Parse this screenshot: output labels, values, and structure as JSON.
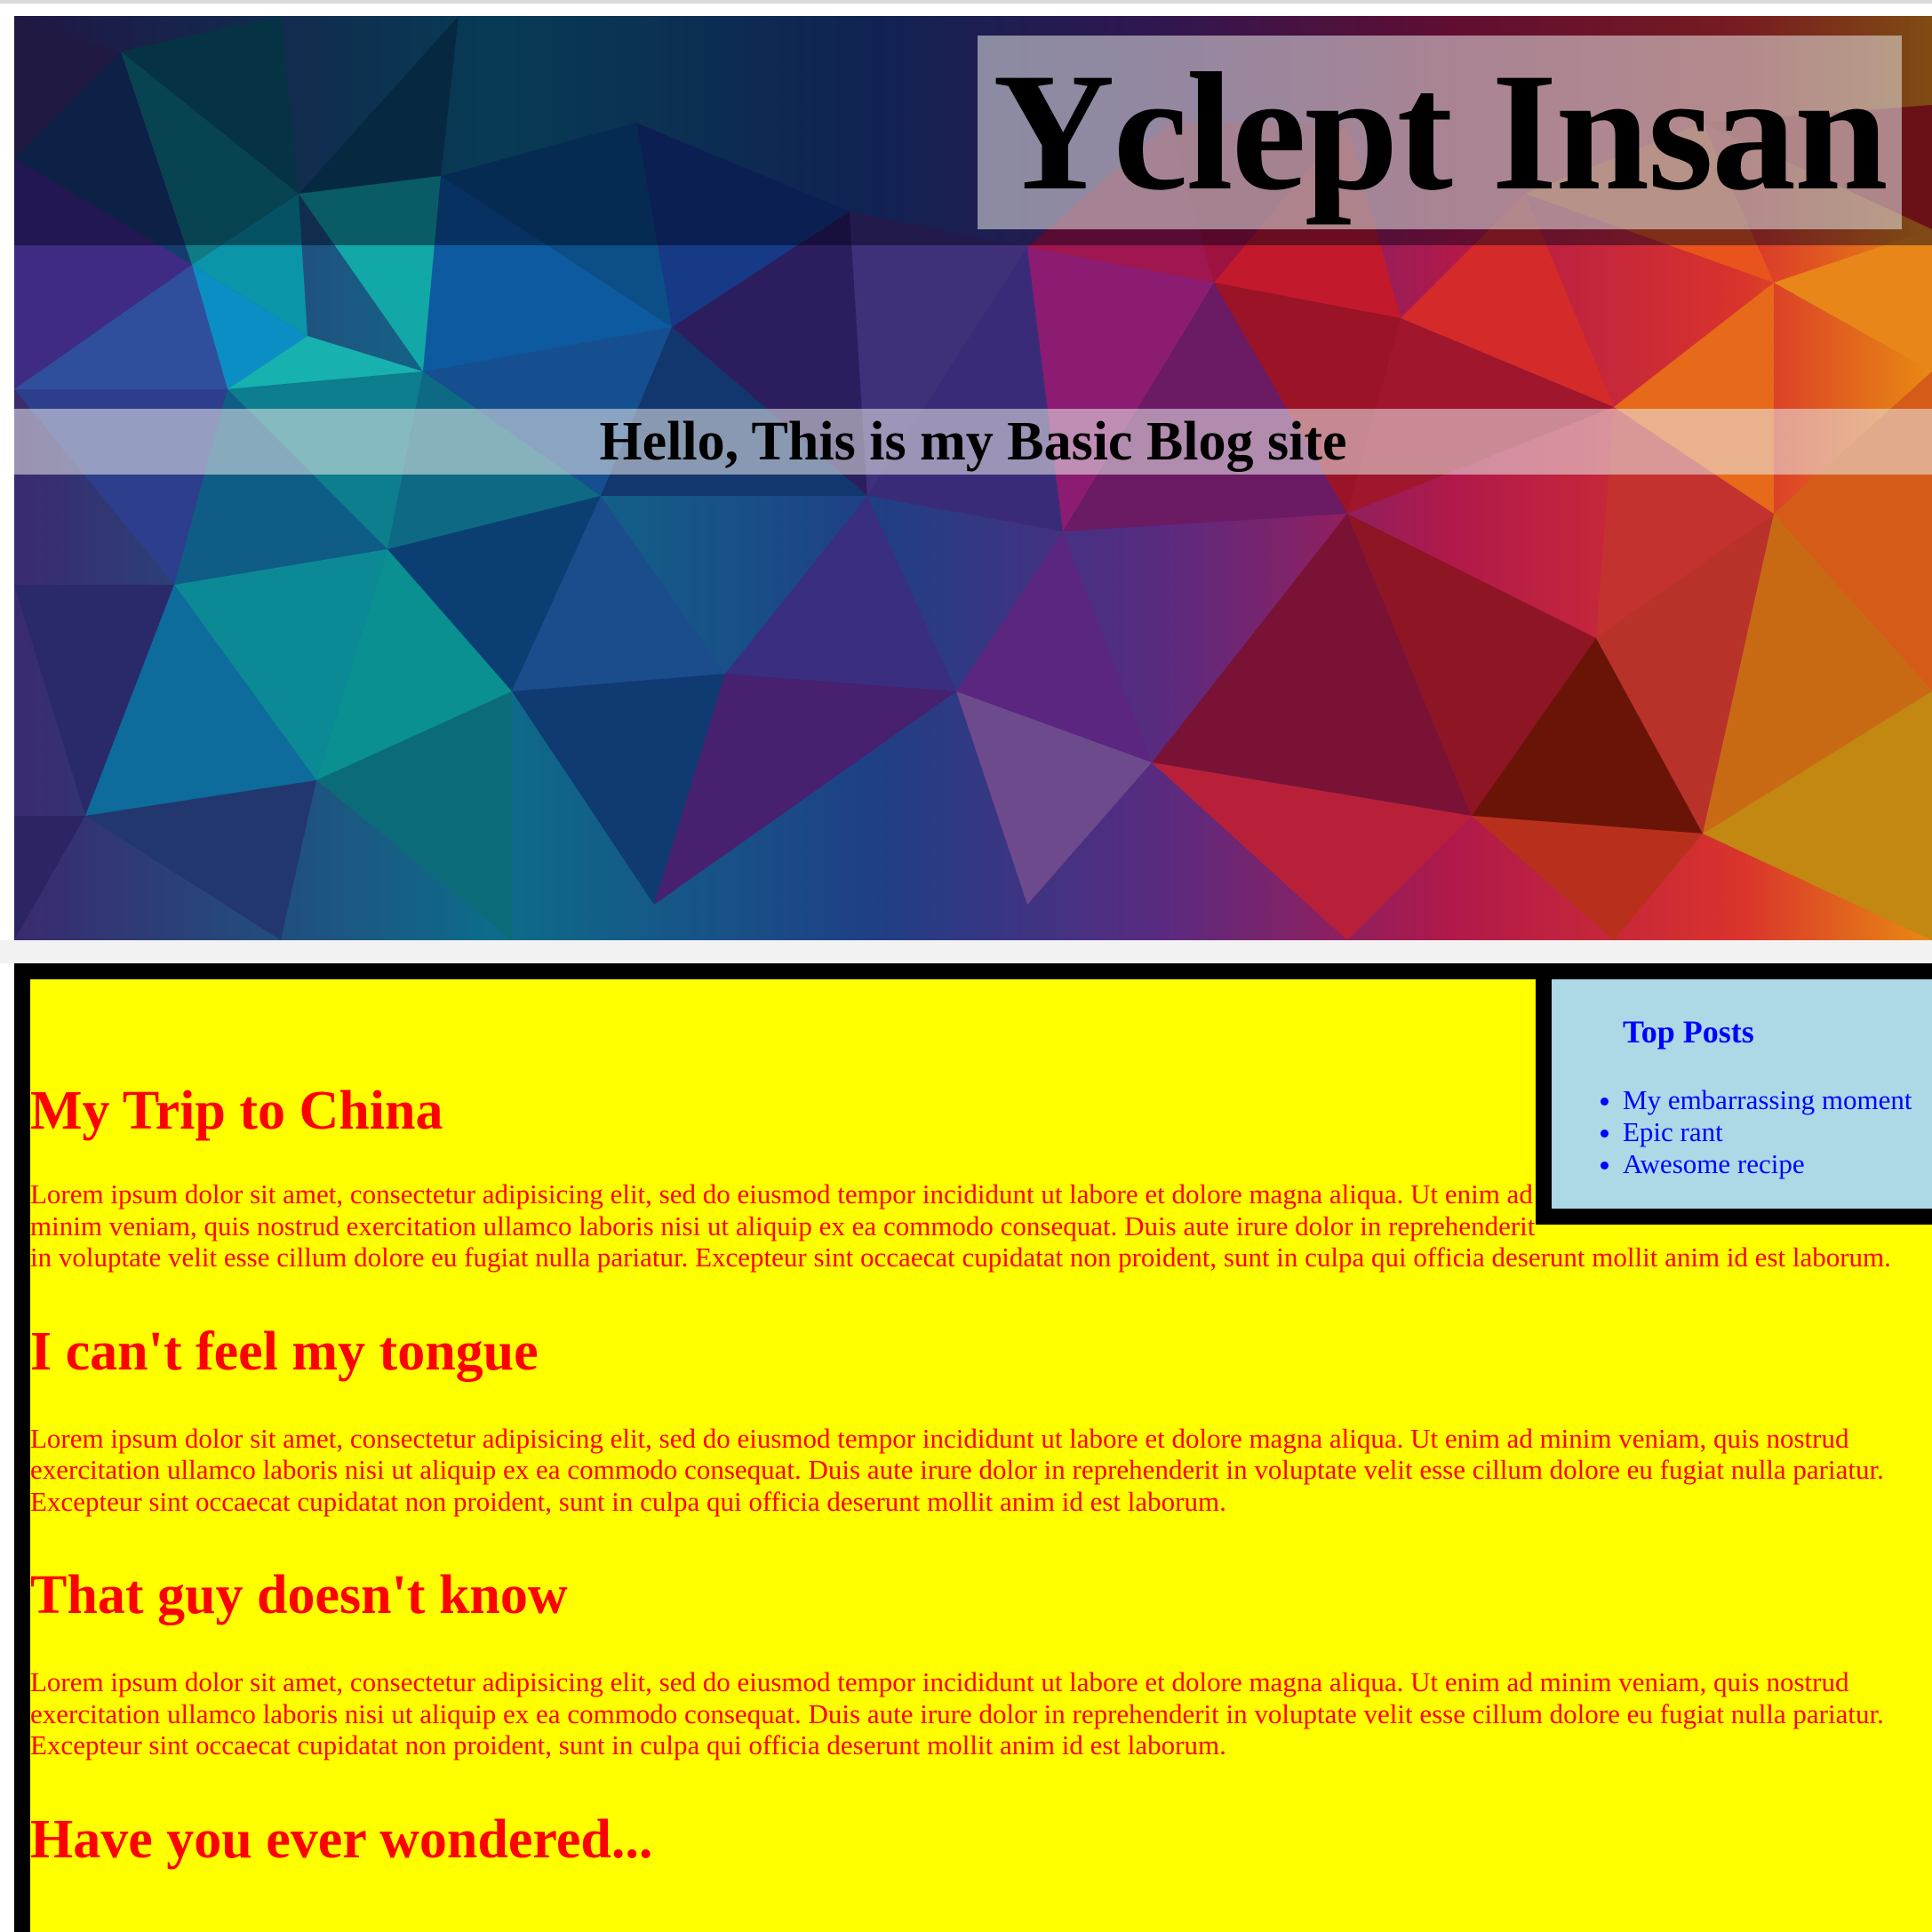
{
  "site": {
    "title": "Yclept Insan",
    "tagline": "Hello, This is my Basic Blog site"
  },
  "sidebar": {
    "title": "Top Posts",
    "items": [
      "My embarrassing moment",
      "Epic rant",
      "Awesome recipe"
    ]
  },
  "posts": [
    {
      "title": "My Trip to China",
      "body": "Lorem ipsum dolor sit amet, consectetur adipisicing elit, sed do eiusmod tempor incididunt ut labore et dolore magna aliqua. Ut enim ad minim veniam, quis nostrud exercitation ullamco laboris nisi ut aliquip ex ea commodo consequat. Duis aute irure dolor in reprehenderit in voluptate velit esse cillum dolore eu fugiat nulla pariatur. Excepteur sint occaecat cupidatat non proident, sunt in culpa qui officia deserunt mollit anim id est laborum."
    },
    {
      "title": "I can't feel my tongue",
      "body": "Lorem ipsum dolor sit amet, consectetur adipisicing elit, sed do eiusmod tempor incididunt ut labore et dolore magna aliqua. Ut enim ad minim veniam, quis nostrud exercitation ullamco laboris nisi ut aliquip ex ea commodo consequat. Duis aute irure dolor in reprehenderit in voluptate velit esse cillum dolore eu fugiat nulla pariatur. Excepteur sint occaecat cupidatat non proident, sunt in culpa qui officia deserunt mollit anim id est laborum."
    },
    {
      "title": "That guy doesn't know",
      "body": "Lorem ipsum dolor sit amet, consectetur adipisicing elit, sed do eiusmod tempor incididunt ut labore et dolore magna aliqua. Ut enim ad minim veniam, quis nostrud exercitation ullamco laboris nisi ut aliquip ex ea commodo consequat. Duis aute irure dolor in reprehenderit in voluptate velit esse cillum dolore eu fugiat nulla pariatur. Excepteur sint occaecat cupidatat non proident, sunt in culpa qui officia deserunt mollit anim id est laborum."
    },
    {
      "title": "Have you ever wondered...",
      "body": ""
    }
  ],
  "colors": {
    "content_background": "#ffff00",
    "post_text": "#ff0000",
    "sidebar_background": "#add8e6",
    "sidebar_text": "#0000ff",
    "border": "#000000"
  }
}
